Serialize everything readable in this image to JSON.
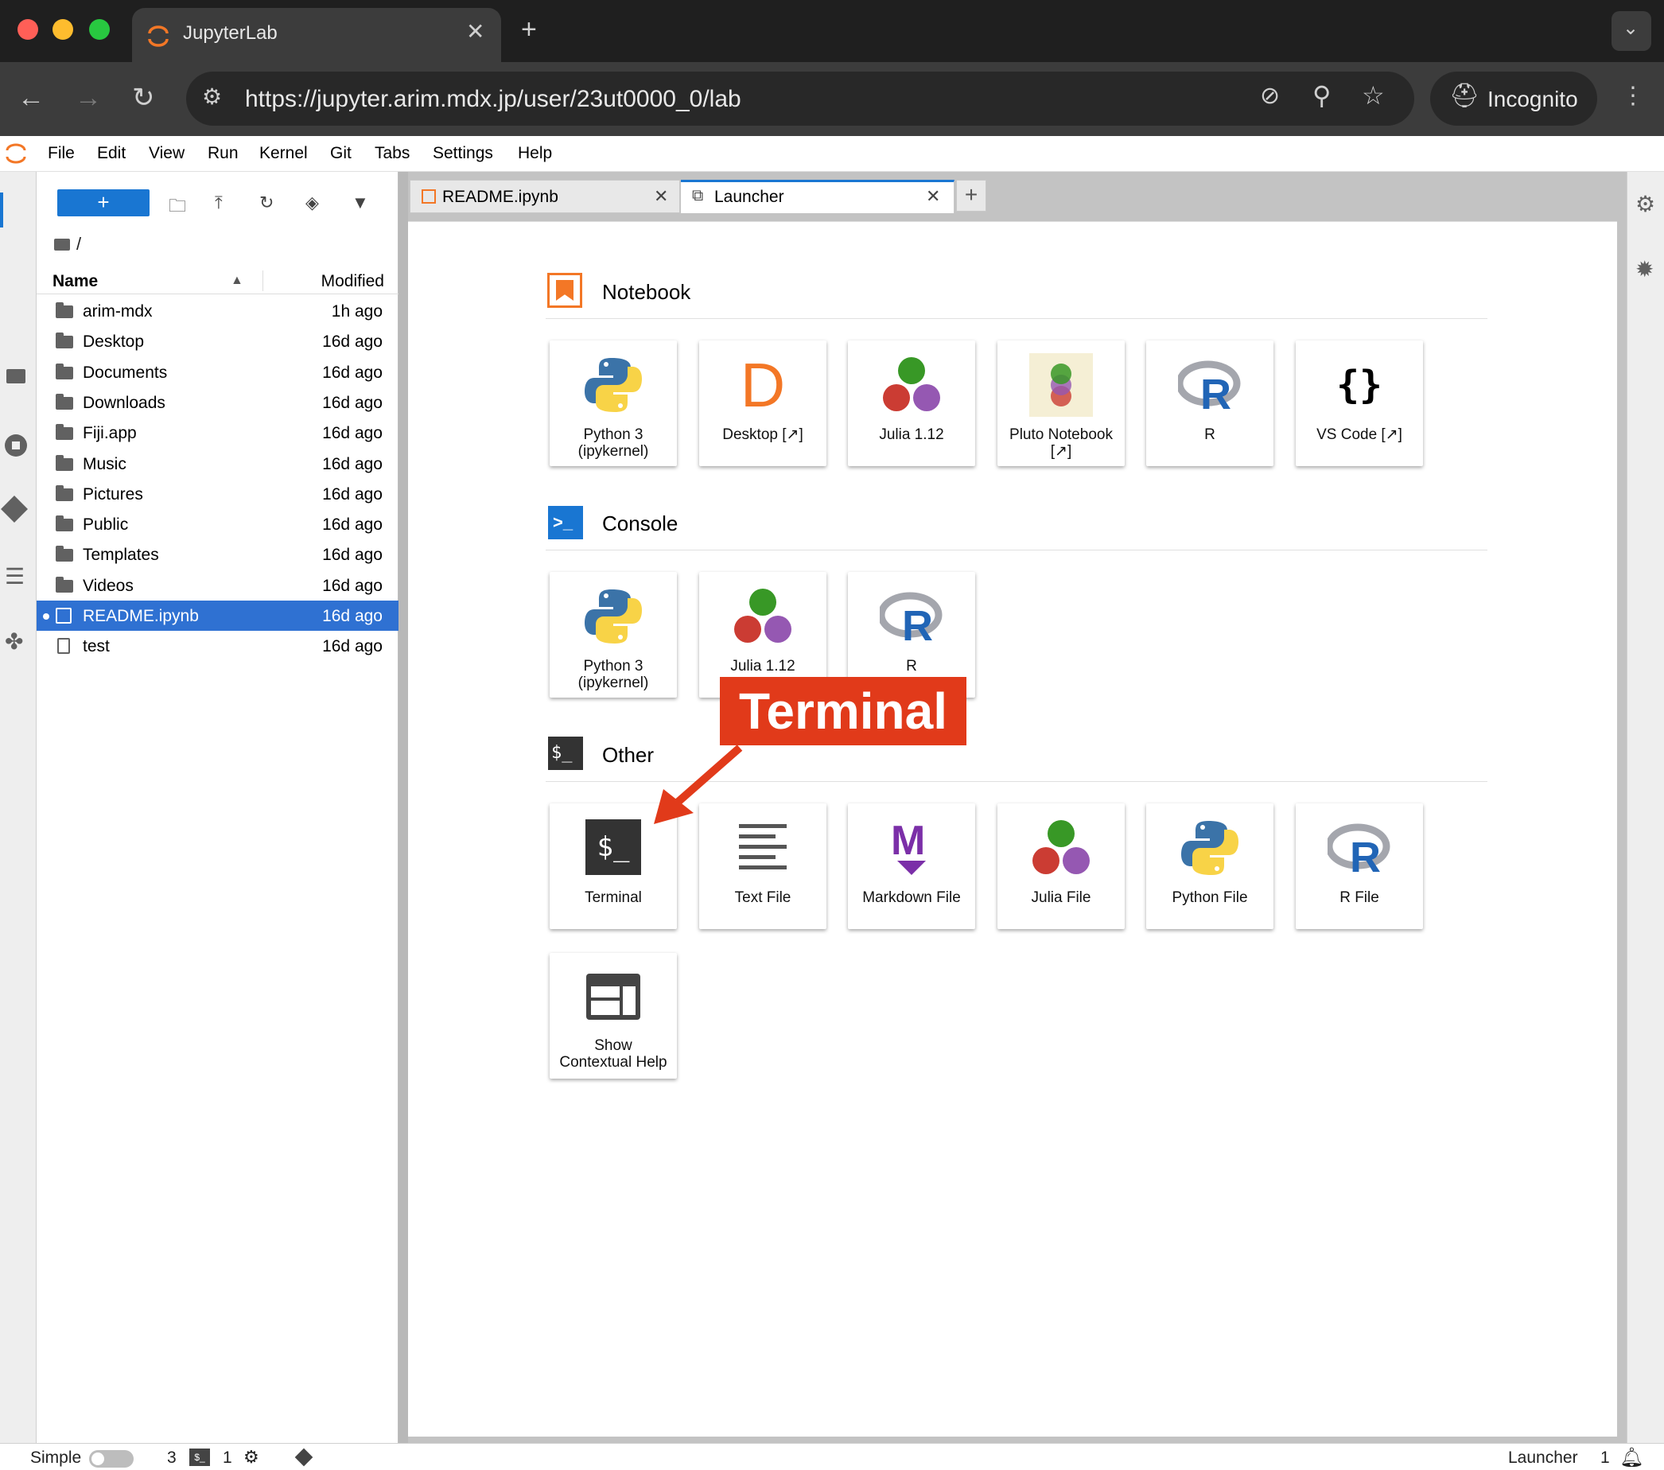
{
  "browser": {
    "tab_title": "JupyterLab",
    "url": "https://jupyter.arim.mdx.jp/user/23ut0000_0/lab",
    "profile_label": "Incognito"
  },
  "menu": [
    "File",
    "Edit",
    "View",
    "Run",
    "Kernel",
    "Git",
    "Tabs",
    "Settings",
    "Help"
  ],
  "filebrowser": {
    "new_label": "+",
    "breadcrumb": "/",
    "col_name": "Name",
    "col_modified": "Modified",
    "items": [
      {
        "name": "arim-mdx",
        "modified": "1h ago"
      },
      {
        "name": "Desktop",
        "modified": "16d ago"
      },
      {
        "name": "Documents",
        "modified": "16d ago"
      },
      {
        "name": "Downloads",
        "modified": "16d ago"
      },
      {
        "name": "Fiji.app",
        "modified": "16d ago"
      },
      {
        "name": "Music",
        "modified": "16d ago"
      },
      {
        "name": "Pictures",
        "modified": "16d ago"
      },
      {
        "name": "Public",
        "modified": "16d ago"
      },
      {
        "name": "Templates",
        "modified": "16d ago"
      },
      {
        "name": "Videos",
        "modified": "16d ago"
      },
      {
        "name": "README.ipynb",
        "modified": "16d ago"
      },
      {
        "name": "test",
        "modified": "16d ago"
      }
    ]
  },
  "tabs": {
    "readme": "README.ipynb",
    "launcher": "Launcher"
  },
  "launcher": {
    "notebook_title": "Notebook",
    "console_title": "Console",
    "other_title": "Other",
    "notebook_cards": [
      "Python 3\n(ipykernel)",
      "Desktop [↗]",
      "Julia 1.12",
      "Pluto Notebook\n[↗]",
      "R",
      "VS Code [↗]"
    ],
    "console_cards": [
      "Python 3\n(ipykernel)",
      "Julia 1.12",
      "R"
    ],
    "other_cards": [
      "Terminal",
      "Text File",
      "Markdown File",
      "Julia File",
      "Python File",
      "R File",
      "Show\nContextual Help"
    ]
  },
  "annotation": "Terminal",
  "status": {
    "mode": "Simple",
    "terminals_count": "3",
    "kernels_count": "1",
    "right_label": "Launcher",
    "notif_count": "1"
  },
  "colors": {
    "accent": "#1976d2",
    "selection": "#2f71d2",
    "jupyter_orange": "#f37726",
    "annotation": "#e13a1a"
  }
}
